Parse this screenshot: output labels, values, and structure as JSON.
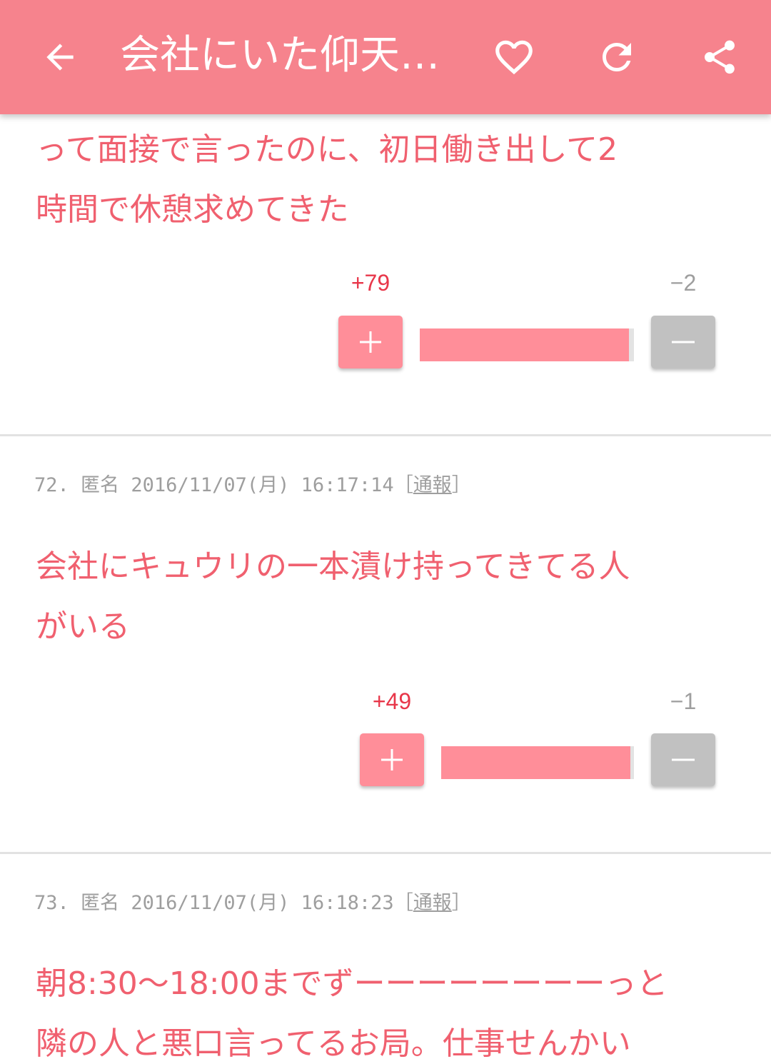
{
  "appbar": {
    "title": "会社にいた仰天…",
    "icons": [
      "arrow-back-icon",
      "heart-icon",
      "refresh-icon",
      "share-icon"
    ]
  },
  "posts": [
    {
      "text": "って面接で言ったのに、初日働き出して2\n時間で休憩求めてきた",
      "plus": "+79",
      "minus": "−2",
      "plus_fraction": 0.975
    },
    {
      "number": "72.",
      "author": "匿名",
      "datetime": "2016/11/07(月) 16:17:14",
      "report_open": "［",
      "report_label": "通報",
      "report_close": "］",
      "text": "会社にキュウリの一本漬け持ってきてる人\nがいる",
      "plus": "+49",
      "minus": "−1",
      "plus_fraction": 0.98
    },
    {
      "number": "73.",
      "author": "匿名",
      "datetime": "2016/11/07(月) 16:18:23",
      "report_open": "［",
      "report_label": "通報",
      "report_close": "］",
      "text": "朝8:30〜18:00までずーーーーーーーーっと\n隣の人と悪口言ってるお局。仕事せんかい"
    }
  ],
  "colors": {
    "accent": "#f6838d",
    "text_pink": "#f0606f",
    "plus_red": "#e8374a",
    "bar_fill": "#ff8e99",
    "minus_gray": "#c1c1c1"
  }
}
